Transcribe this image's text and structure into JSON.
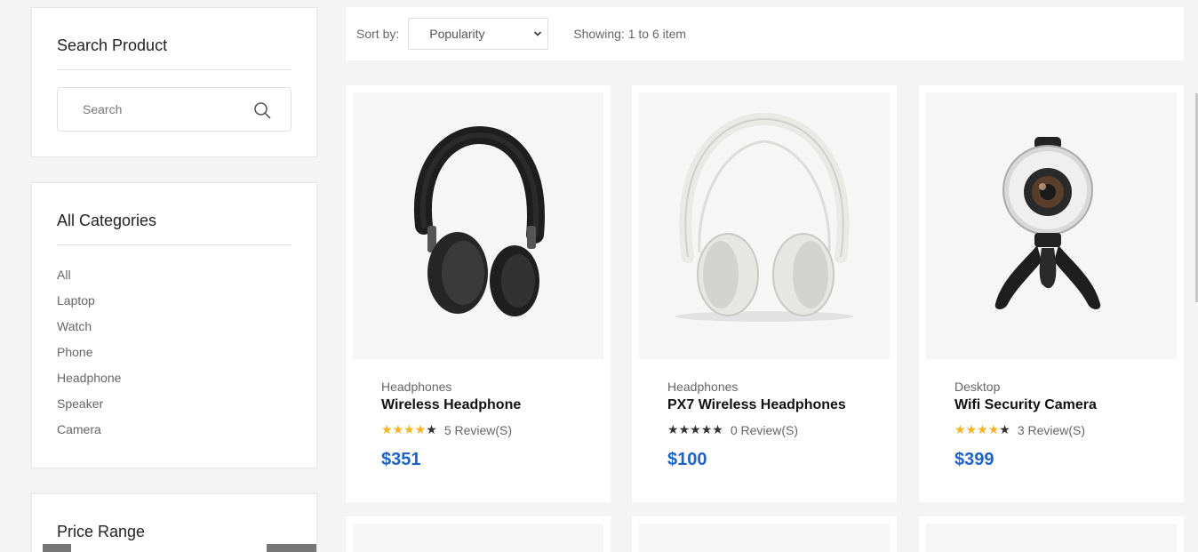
{
  "sidebar": {
    "search": {
      "title": "Search Product",
      "placeholder": "Search",
      "icon": "search-icon"
    },
    "categories": {
      "title": "All Categories",
      "items": [
        "All",
        "Laptop",
        "Watch",
        "Phone",
        "Headphone",
        "Speaker",
        "Camera"
      ]
    },
    "price": {
      "title": "Price Range"
    }
  },
  "toolbar": {
    "sort_label": "Sort by:",
    "sort_value": "Popularity",
    "showing": "Showing: 1 to 6 item"
  },
  "products": [
    {
      "category": "Headphones",
      "name": "Wireless Headphone",
      "rating": 4,
      "max_rating": 5,
      "reviews": "5 Review(S)",
      "price": "$351",
      "image": "black-headphone"
    },
    {
      "category": "Headphones",
      "name": "PX7 Wireless Headphones",
      "rating": 0,
      "max_rating": 5,
      "reviews": "0 Review(S)",
      "price": "$100",
      "image": "white-headphone"
    },
    {
      "category": "Desktop",
      "name": "Wifi Security Camera",
      "rating": 4,
      "max_rating": 5,
      "reviews": "3 Review(S)",
      "price": "$399",
      "image": "360-camera"
    }
  ],
  "colors": {
    "price": "#1d63c9",
    "star_on": "#f5b320",
    "star_off": "#333333"
  }
}
